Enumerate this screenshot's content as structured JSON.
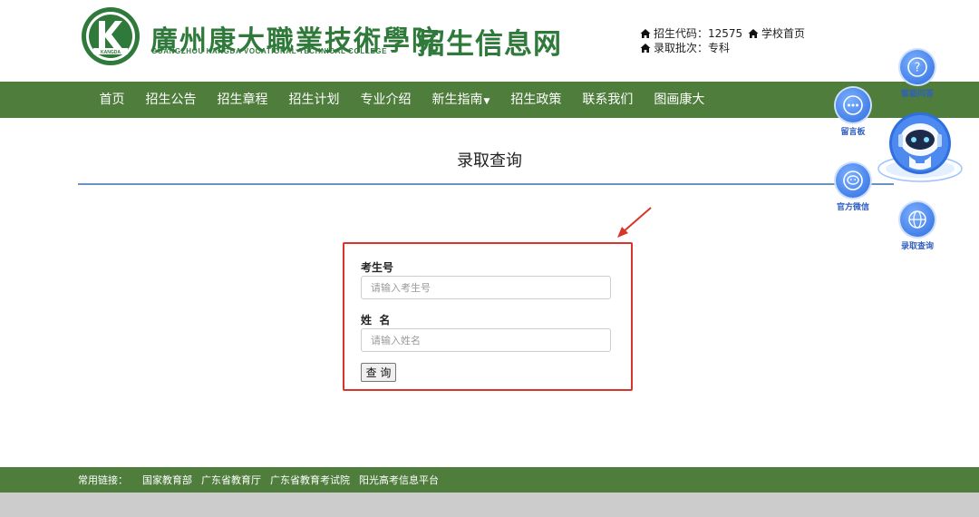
{
  "header": {
    "college_name_cn": "廣州康大職業技術學院",
    "college_name_en": "GUANGZHOU KANGDA VOCATIONAL TECHNICAL COLLEGE",
    "logo_text": "KANGDA",
    "site_name": "招生信息网",
    "enroll_code": "招生代码：12575",
    "school_home": "学校首页",
    "admission_batch": "录取批次：专科",
    "brand_color": "#2f7a3a"
  },
  "nav": {
    "items": [
      {
        "label": "首页"
      },
      {
        "label": "招生公告"
      },
      {
        "label": "招生章程"
      },
      {
        "label": "招生计划"
      },
      {
        "label": "专业介绍"
      },
      {
        "label": "新生指南"
      },
      {
        "label": "招生政策"
      },
      {
        "label": "联系我们"
      },
      {
        "label": "图画康大"
      }
    ],
    "background": "#4e7d3c"
  },
  "page": {
    "title": "录取查询"
  },
  "form": {
    "exam_no_label": "考生号",
    "exam_no_placeholder": "请输入考生号",
    "exam_no_value": "",
    "name_label": "姓  名",
    "name_placeholder": "请输入姓名",
    "name_value": "",
    "submit_label": "查 询",
    "highlight_color": "#d8342a"
  },
  "floating": {
    "faq": "智能问答",
    "message_board": "留言板",
    "wechat": "官方微信",
    "admission_query": "录取查询",
    "icons": [
      "question-icon",
      "chat-dots-icon",
      "wechat-icon",
      "globe-icon",
      "robot-icon"
    ]
  },
  "footer": {
    "label": "常用链接：",
    "links": [
      "国家教育部",
      "广东省教育厅",
      "广东省教育考试院",
      "阳光高考信息平台"
    ]
  }
}
